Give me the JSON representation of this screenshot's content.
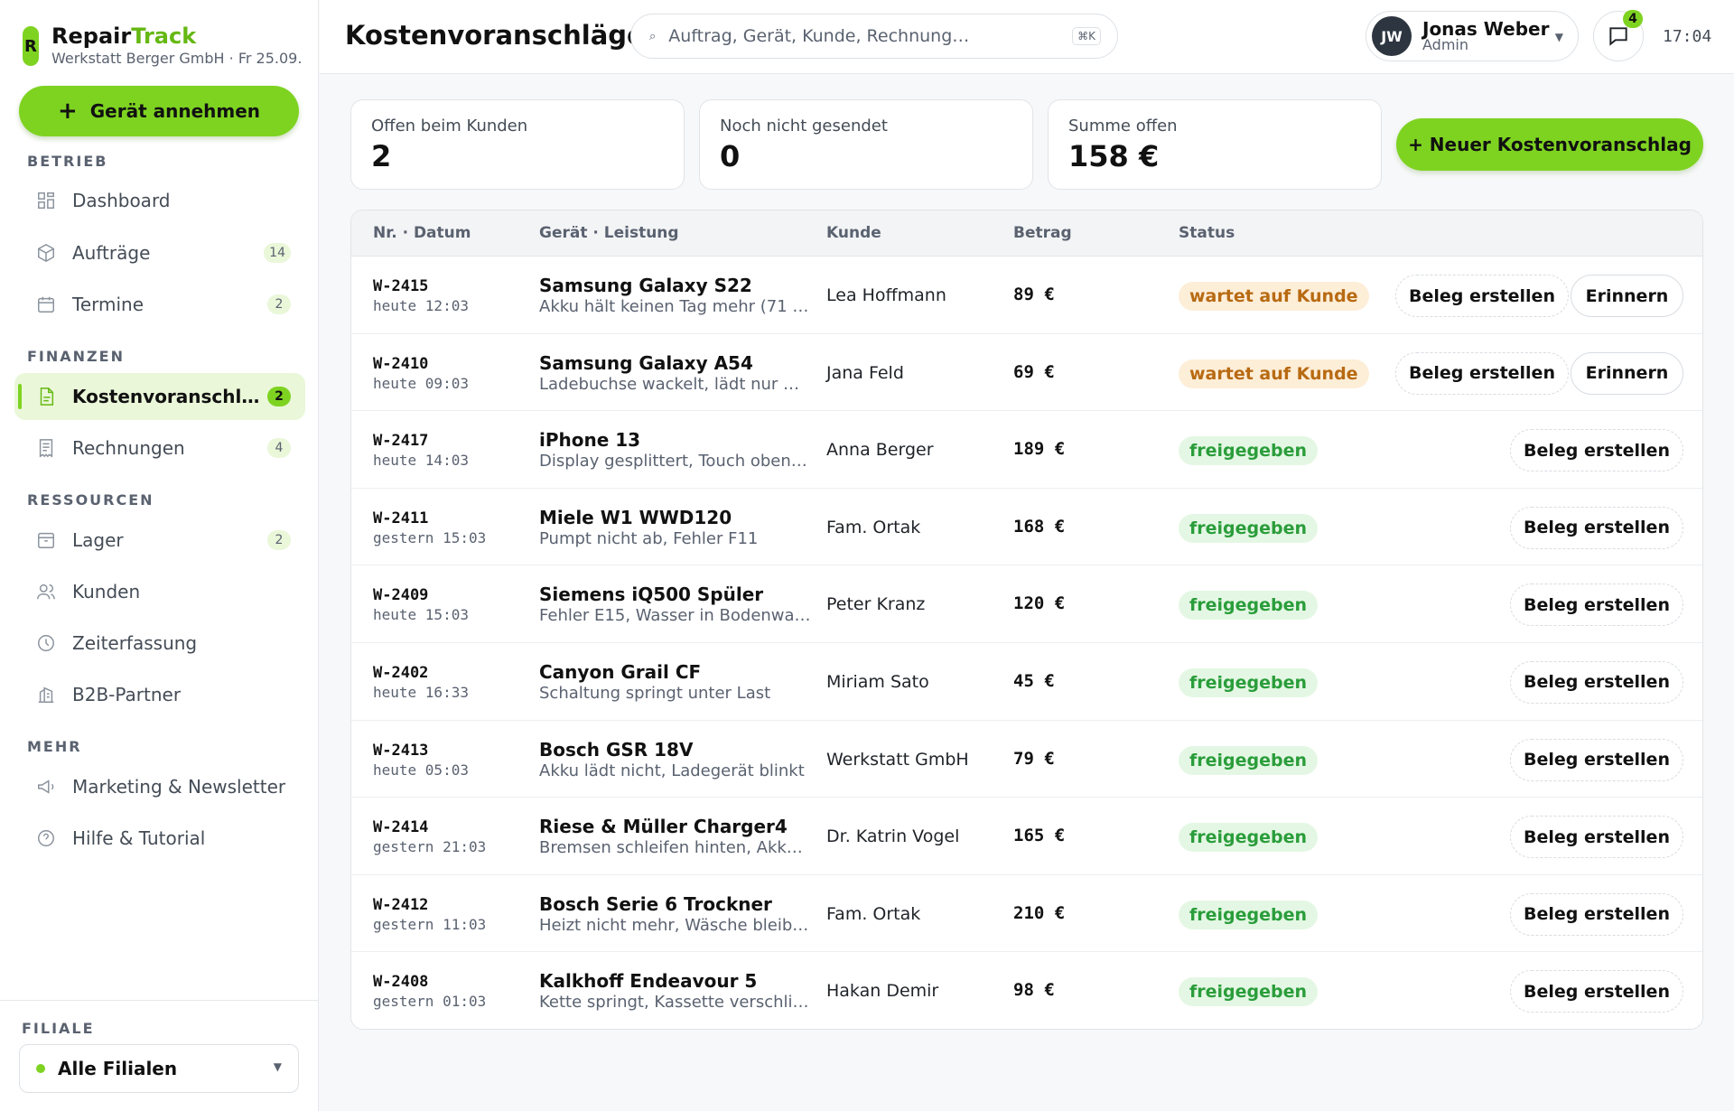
{
  "brand": {
    "name_main": "Repair",
    "name_accent": "Track",
    "logo_letter": "R",
    "subtitle": "Werkstatt Berger GmbH · Fr 25.09."
  },
  "primary_action": {
    "icon": "+",
    "label": "Gerät annehmen"
  },
  "nav": {
    "sections": [
      {
        "title": "BETRIEB"
      },
      {
        "title": "FINANZEN"
      },
      {
        "title": "RESSOURCEN"
      },
      {
        "title": "MEHR"
      }
    ],
    "items": [
      {
        "label": "Dashboard",
        "icon": "dashboard-icon",
        "badge": ""
      },
      {
        "label": "Aufträge",
        "icon": "box-icon",
        "badge": "14"
      },
      {
        "label": "Termine",
        "icon": "calendar-icon",
        "badge": "2"
      },
      {
        "label": "Kostenvoranschläge",
        "icon": "document-icon",
        "badge": "2",
        "active": true
      },
      {
        "label": "Rechnungen",
        "icon": "receipt-icon",
        "badge": "4"
      },
      {
        "label": "Lager",
        "icon": "archive-icon",
        "badge": "2"
      },
      {
        "label": "Kunden",
        "icon": "users-icon",
        "badge": ""
      },
      {
        "label": "Zeiterfassung",
        "icon": "clock-icon",
        "badge": ""
      },
      {
        "label": "B2B-Partner",
        "icon": "building-icon",
        "badge": ""
      },
      {
        "label": "Marketing & Newsletter",
        "icon": "megaphone-icon",
        "badge": ""
      },
      {
        "label": "Hilfe & Tutorial",
        "icon": "help-icon",
        "badge": ""
      }
    ]
  },
  "branch": {
    "label": "FILIALE",
    "value": "Alle Filialen"
  },
  "header": {
    "title": "Kostenvoranschläge",
    "search_placeholder": "Auftrag, Gerät, Kunde, Rechnung…",
    "search_shortcut": "⌘K",
    "user": {
      "initials": "JW",
      "name": "Jonas Weber",
      "role": "Admin"
    },
    "messages_badge": "4",
    "time": "17:04"
  },
  "stats": [
    {
      "label": "Offen beim Kunden",
      "value": "2"
    },
    {
      "label": "Noch nicht gesendet",
      "value": "0"
    },
    {
      "label": "Summe offen",
      "value": "158 €"
    }
  ],
  "new_button": "+ Neuer Kostenvoranschlag",
  "table": {
    "headers": [
      "Nr. · Datum",
      "Gerät · Leistung",
      "Kunde",
      "Betrag",
      "Status"
    ],
    "actions": {
      "create": "Beleg erstellen",
      "remind": "Erinnern"
    },
    "rows": [
      {
        "no": "W-2415",
        "date": "heute 12:03",
        "device": "Samsung Galaxy S22",
        "desc": "Akku hält keinen Tag mehr (71 …",
        "customer": "Lea Hoffmann",
        "amount": "89 €",
        "status": "wartet auf Kunde",
        "status_type": "wait"
      },
      {
        "no": "W-2410",
        "date": "heute 09:03",
        "device": "Samsung Galaxy A54",
        "desc": "Ladebuchse wackelt, lädt nur …",
        "customer": "Jana Feld",
        "amount": "69 €",
        "status": "wartet auf Kunde",
        "status_type": "wait"
      },
      {
        "no": "W-2417",
        "date": "heute 14:03",
        "device": "iPhone 13",
        "desc": "Display gesplittert, Touch oben…",
        "customer": "Anna Berger",
        "amount": "189 €",
        "status": "freigegeben",
        "status_type": "ok"
      },
      {
        "no": "W-2411",
        "date": "gestern 15:03",
        "device": "Miele W1 WWD120",
        "desc": "Pumpt nicht ab, Fehler F11",
        "customer": "Fam. Ortak",
        "amount": "168 €",
        "status": "freigegeben",
        "status_type": "ok"
      },
      {
        "no": "W-2409",
        "date": "heute 15:03",
        "device": "Siemens iQ500 Spüler",
        "desc": "Fehler E15, Wasser in Bodenwa…",
        "customer": "Peter Kranz",
        "amount": "120 €",
        "status": "freigegeben",
        "status_type": "ok"
      },
      {
        "no": "W-2402",
        "date": "heute 16:33",
        "device": "Canyon Grail CF",
        "desc": "Schaltung springt unter Last",
        "customer": "Miriam Sato",
        "amount": "45 €",
        "status": "freigegeben",
        "status_type": "ok"
      },
      {
        "no": "W-2413",
        "date": "heute 05:03",
        "device": "Bosch GSR 18V",
        "desc": "Akku lädt nicht, Ladegerät blinkt",
        "customer": "Werkstatt GmbH",
        "amount": "79 €",
        "status": "freigegeben",
        "status_type": "ok"
      },
      {
        "no": "W-2414",
        "date": "gestern 21:03",
        "device": "Riese & Müller Charger4",
        "desc": "Bremsen schleifen hinten, Akk…",
        "customer": "Dr. Katrin Vogel",
        "amount": "165 €",
        "status": "freigegeben",
        "status_type": "ok"
      },
      {
        "no": "W-2412",
        "date": "gestern 11:03",
        "device": "Bosch Serie 6 Trockner",
        "desc": "Heizt nicht mehr, Wäsche bleib…",
        "customer": "Fam. Ortak",
        "amount": "210 €",
        "status": "freigegeben",
        "status_type": "ok"
      },
      {
        "no": "W-2408",
        "date": "gestern 01:03",
        "device": "Kalkhoff Endeavour 5",
        "desc": "Kette springt, Kassette verschli…",
        "customer": "Hakan Demir",
        "amount": "98 €",
        "status": "freigegeben",
        "status_type": "ok"
      }
    ]
  }
}
